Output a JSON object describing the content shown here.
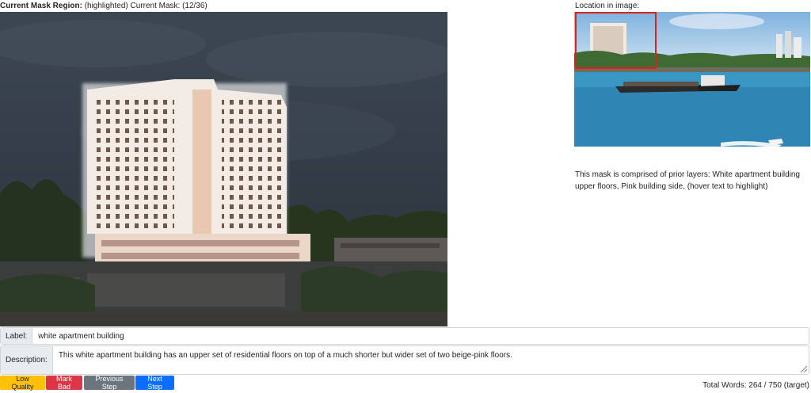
{
  "header": {
    "mask_region_label": "Current Mask Region:",
    "mask_region_value": "(highlighted) Current Mask: (12/36)"
  },
  "location": {
    "label": "Location in image:"
  },
  "mask_composition": "This mask is comprised of prior layers: White apartment building upper floors, Pink building side, (hover text to highlight)",
  "form": {
    "label_addon": "Label:",
    "label_value": "white apartment building",
    "description_addon": "Description:",
    "description_value": "This white apartment building has an upper set of residential floors on top of a much shorter but wider set of two beige-pink floors."
  },
  "buttons": {
    "low_quality": "Low Quality",
    "mark_bad": "Mark Bad",
    "previous_step": "Previous Step",
    "next_step": "Next Step"
  },
  "word_count": "Total Words: 264 / 750 (target)",
  "colors": {
    "highlight_box": "#e0201b",
    "btn_warning": "#ffc107",
    "btn_danger": "#dc3545",
    "btn_secondary": "#6c757d",
    "btn_primary": "#0d6efd"
  }
}
